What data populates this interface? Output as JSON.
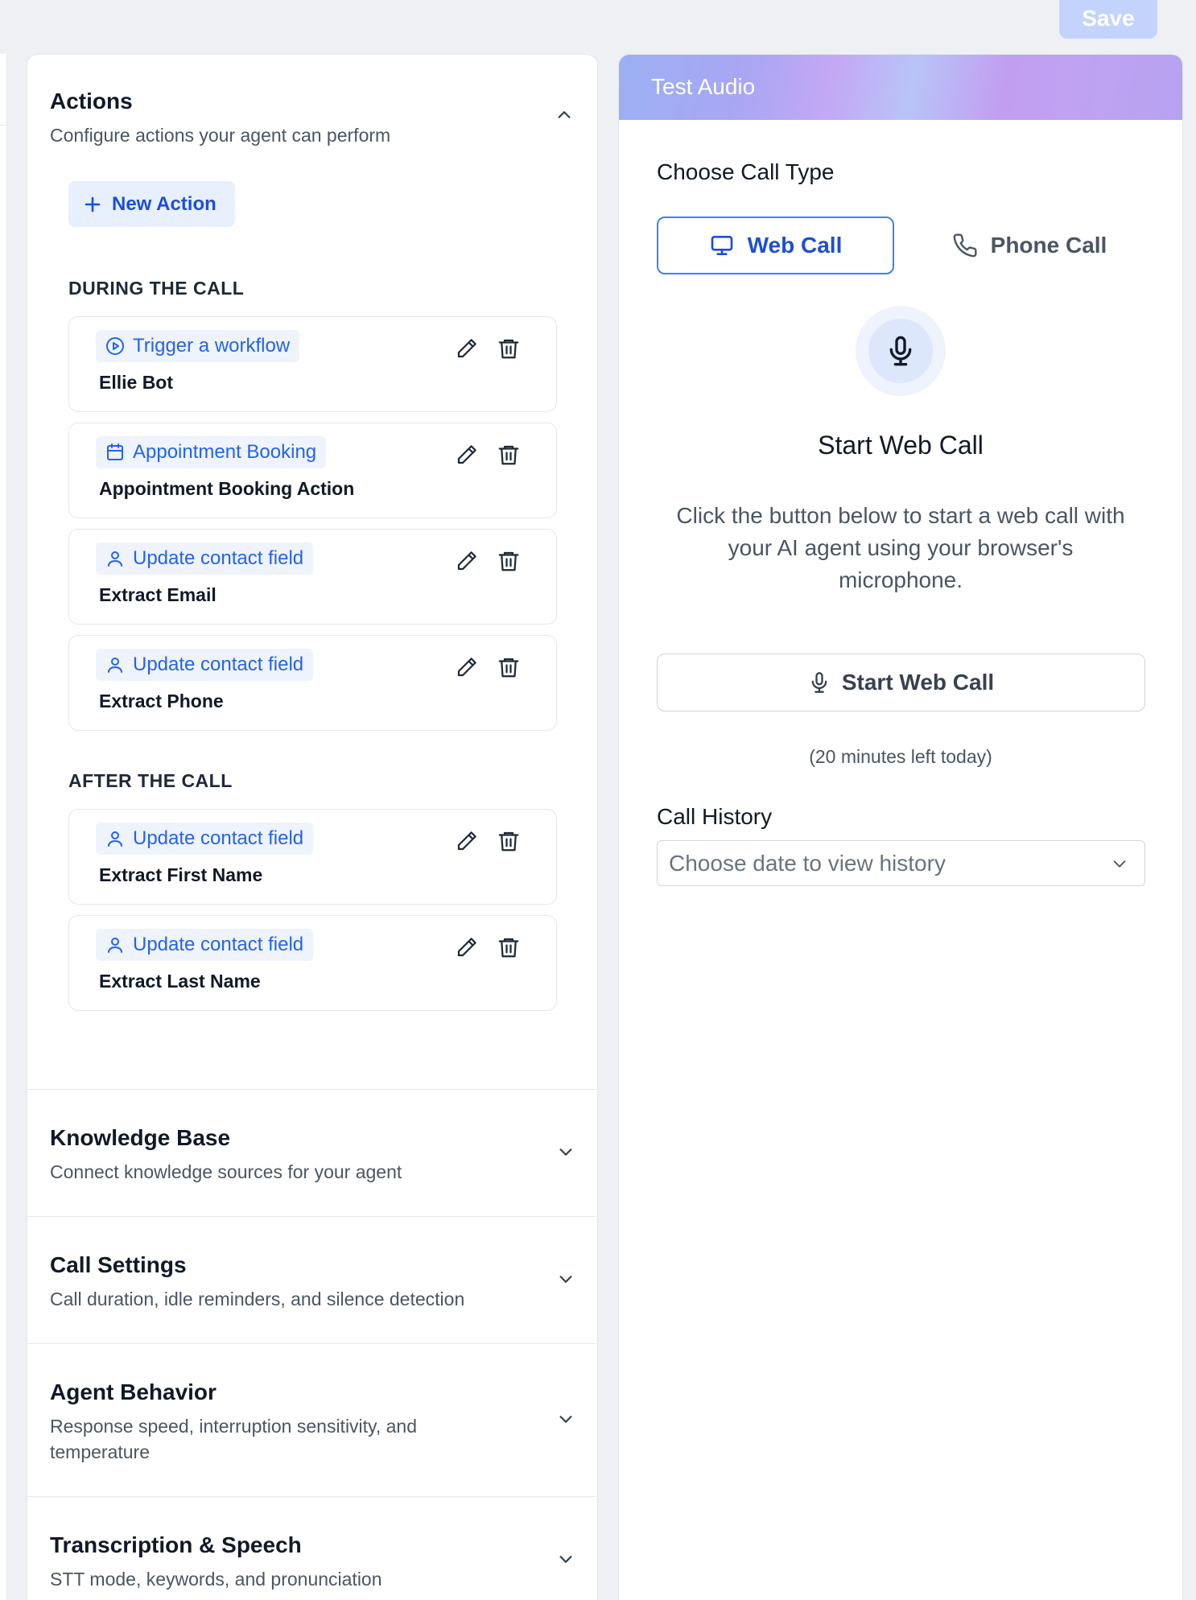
{
  "header": {
    "save_label": "Save"
  },
  "actions": {
    "title": "Actions",
    "subtitle": "Configure actions your agent can perform",
    "new_action_label": "New Action",
    "during_label": "DURING THE CALL",
    "after_label": "AFTER THE CALL",
    "during_items": [
      {
        "tag": "Trigger a workflow",
        "tag_icon": "play-circle-icon",
        "name": "Ellie Bot"
      },
      {
        "tag": "Appointment Booking",
        "tag_icon": "calendar-icon",
        "name": "Appointment Booking Action"
      },
      {
        "tag": "Update contact field",
        "tag_icon": "user-icon",
        "name": "Extract Email"
      },
      {
        "tag": "Update contact field",
        "tag_icon": "user-icon",
        "name": "Extract Phone"
      }
    ],
    "after_items": [
      {
        "tag": "Update contact field",
        "tag_icon": "user-icon",
        "name": "Extract First Name"
      },
      {
        "tag": "Update contact field",
        "tag_icon": "user-icon",
        "name": "Extract Last Name"
      }
    ]
  },
  "sections": [
    {
      "title": "Knowledge Base",
      "subtitle": "Connect knowledge sources for your agent"
    },
    {
      "title": "Call Settings",
      "subtitle": "Call duration, idle reminders, and silence detection"
    },
    {
      "title": "Agent Behavior",
      "subtitle": "Response speed, interruption sensitivity, and temperature"
    },
    {
      "title": "Transcription & Speech",
      "subtitle": "STT mode, keywords, and pronunciation"
    }
  ],
  "test_audio": {
    "title": "Test Audio",
    "choose_type_label": "Choose Call Type",
    "web_call_label": "Web Call",
    "phone_call_label": "Phone Call",
    "selected_type": "Web Call",
    "start_title": "Start Web Call",
    "start_description": "Click the button below to start a web call with your AI agent using your browser's microphone.",
    "start_button_label": "Start Web Call",
    "minutes_left": "(20 minutes left today)",
    "history_label": "Call History",
    "history_placeholder": "Choose date to view history"
  },
  "colors": {
    "accent": "#2563eb",
    "accent_bg": "#e8effd",
    "save_disabled": "#c3d3fb",
    "page_bg": "#eef0f4"
  }
}
